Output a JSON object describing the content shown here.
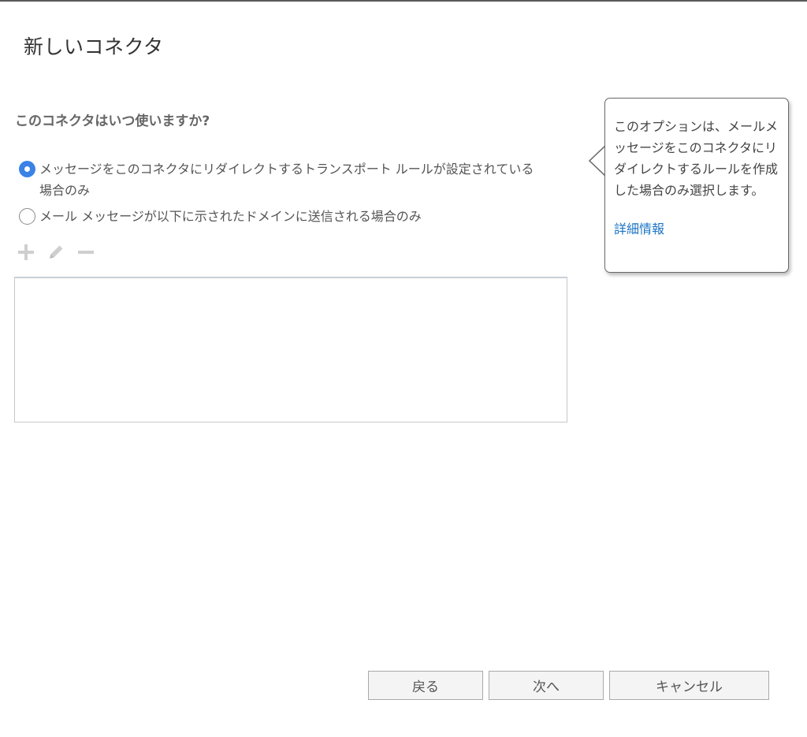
{
  "dialog": {
    "title": "新しいコネクタ"
  },
  "question": {
    "label": "このコネクタはいつ使いますか?"
  },
  "options": [
    {
      "label": "メッセージをこのコネクタにリダイレクトするトランスポート ルールが設定されている場合のみ",
      "selected": true
    },
    {
      "label": "メール メッセージが以下に示されたドメインに送信される場合のみ",
      "selected": false
    }
  ],
  "toolbar": {
    "icons": [
      "add-icon",
      "edit-icon",
      "remove-icon"
    ]
  },
  "callout": {
    "text": "このオプションは、メールメッセージをこのコネクタにリダイレクトするルールを作成した場合のみ選択します。",
    "link": "詳細情報"
  },
  "footer": {
    "back_label": "戻る",
    "next_label": "次へ",
    "cancel_label": "キャンセル"
  },
  "colors": {
    "accent": "#3b82e6",
    "link": "#1a73c4",
    "disabled_icon": "#cfcfcf"
  }
}
